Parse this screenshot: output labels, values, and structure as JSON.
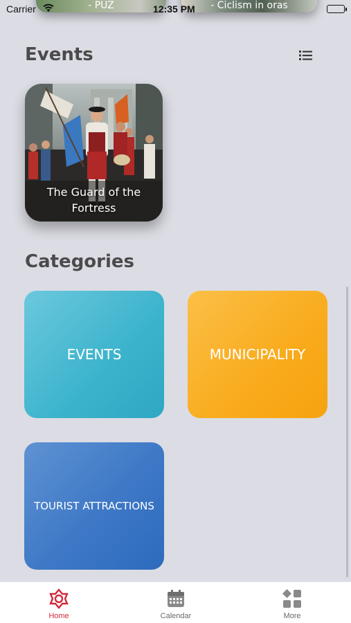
{
  "status_bar": {
    "carrier": "Carrier",
    "time": "12:35 PM"
  },
  "top_cards": [
    {
      "caption": "- PUZ"
    },
    {
      "caption": "- Ciclism in oras"
    }
  ],
  "events_section": {
    "title": "Events",
    "list_icon": "list-icon",
    "cards": [
      {
        "caption": "The Guard of the Fortress"
      }
    ]
  },
  "categories_section": {
    "title": "Categories",
    "tiles": [
      {
        "label": "EVENTS",
        "color": "#3bb3cc"
      },
      {
        "label": "MUNICIPALITY",
        "color": "#f9ab1c"
      },
      {
        "label": "TOURIST ATTRACTIONS",
        "color": "#3e78c6"
      }
    ]
  },
  "tab_bar": {
    "active_color": "#d0283a",
    "tabs": [
      {
        "label": "Home",
        "icon": "home-emblem-icon",
        "active": true
      },
      {
        "label": "Calendar",
        "icon": "calendar-icon",
        "active": false
      },
      {
        "label": "More",
        "icon": "grid-more-icon",
        "active": false
      }
    ]
  }
}
